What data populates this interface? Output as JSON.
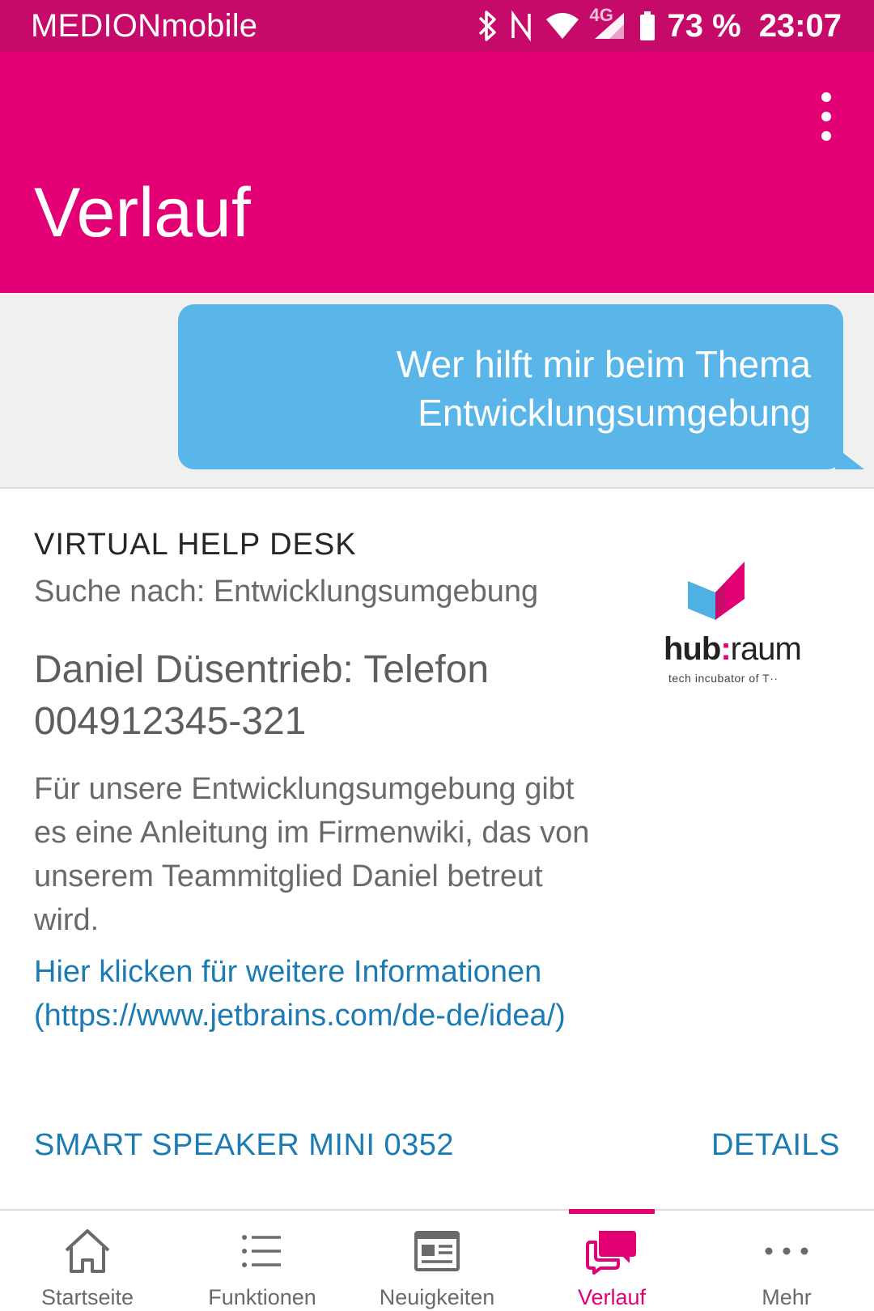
{
  "status_bar": {
    "carrier": "MEDIONmobile",
    "icons": [
      "bluetooth-icon",
      "nfc-icon",
      "wifi-icon",
      "4g-signal-icon",
      "battery-icon"
    ],
    "network_label": "4G",
    "battery_percent": "73 %",
    "time": "23:07"
  },
  "app_bar": {
    "title": "Verlauf",
    "menu_icon": "overflow-menu-icon"
  },
  "chat": {
    "user_message_line1": "Wer hilft mir beim Thema",
    "user_message_line2": "Entwicklungsumgebung"
  },
  "card": {
    "label": "VIRTUAL HELP DESK",
    "subtitle": "Suche nach: Entwicklungsumgebung",
    "headline": "Daniel Düsentrieb: Telefon 004912345-321",
    "body": "Für unsere Entwicklungsumgebung gibt es eine Anleitung im Firmenwiki, das von unserem Teammitglied Daniel betreut wird.",
    "link": "Hier klicken für weitere Informationen (https://www.jetbrains.com/de-de/idea/)",
    "logo": {
      "word_bold": "hub",
      "word_sep": ":",
      "word_light": "raum",
      "tagline": "tech incubator of T··"
    },
    "footer_device": "SMART SPEAKER MINI 0352",
    "footer_action": "DETAILS"
  },
  "bottom_nav": {
    "items": [
      {
        "label": "Startseite",
        "icon": "home-icon"
      },
      {
        "label": "Funktionen",
        "icon": "list-icon"
      },
      {
        "label": "Neuigkeiten",
        "icon": "news-icon"
      },
      {
        "label": "Verlauf",
        "icon": "chat-bubbles-icon",
        "active": true
      },
      {
        "label": "Mehr",
        "icon": "more-dots-icon"
      }
    ]
  },
  "colors": {
    "brand_magenta": "#e20074",
    "status_bar": "#c50a69",
    "bubble_blue": "#5ab5e8",
    "link_blue": "#1c7bb3"
  }
}
